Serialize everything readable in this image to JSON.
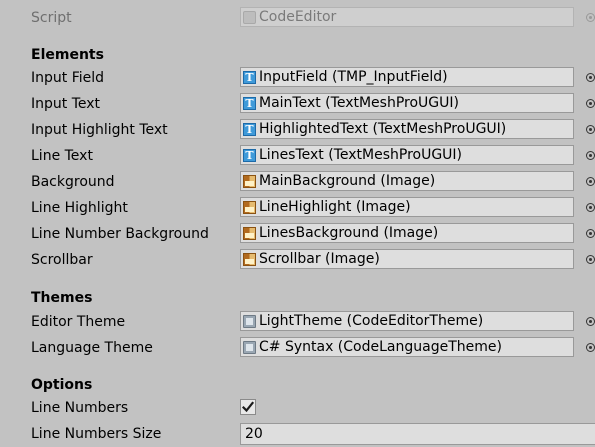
{
  "script_row": {
    "label": "Script",
    "value": "CodeEditor",
    "icon": "script-icon"
  },
  "sections": {
    "elements": "Elements",
    "themes": "Themes",
    "options": "Options"
  },
  "elements": [
    {
      "label": "Input Field",
      "value": "InputField (TMP_InputField)",
      "icon": "tmp-icon"
    },
    {
      "label": "Input Text",
      "value": "MainText (TextMeshProUGUI)",
      "icon": "tmp-icon"
    },
    {
      "label": "Input Highlight Text",
      "value": "HighlightedText (TextMeshProUGUI)",
      "icon": "tmp-icon"
    },
    {
      "label": "Line Text",
      "value": "LinesText (TextMeshProUGUI)",
      "icon": "tmp-icon"
    },
    {
      "label": "Background",
      "value": "MainBackground (Image)",
      "icon": "image-icon"
    },
    {
      "label": "Line Highlight",
      "value": "LineHighlight (Image)",
      "icon": "image-icon"
    },
    {
      "label": "Line Number Background",
      "value": "LinesBackground (Image)",
      "icon": "image-icon"
    },
    {
      "label": "Scrollbar",
      "value": "Scrollbar (Image)",
      "icon": "image-icon"
    }
  ],
  "themes": [
    {
      "label": "Editor Theme",
      "value": "LightTheme (CodeEditorTheme)",
      "icon": "scriptable-object-icon"
    },
    {
      "label": "Language Theme",
      "value": "C# Syntax (CodeLanguageTheme)",
      "icon": "scriptable-object-icon"
    }
  ],
  "options": {
    "line_numbers_label": "Line Numbers",
    "line_numbers_checked": true,
    "line_numbers_size_label": "Line Numbers Size",
    "line_numbers_size_value": "20"
  }
}
